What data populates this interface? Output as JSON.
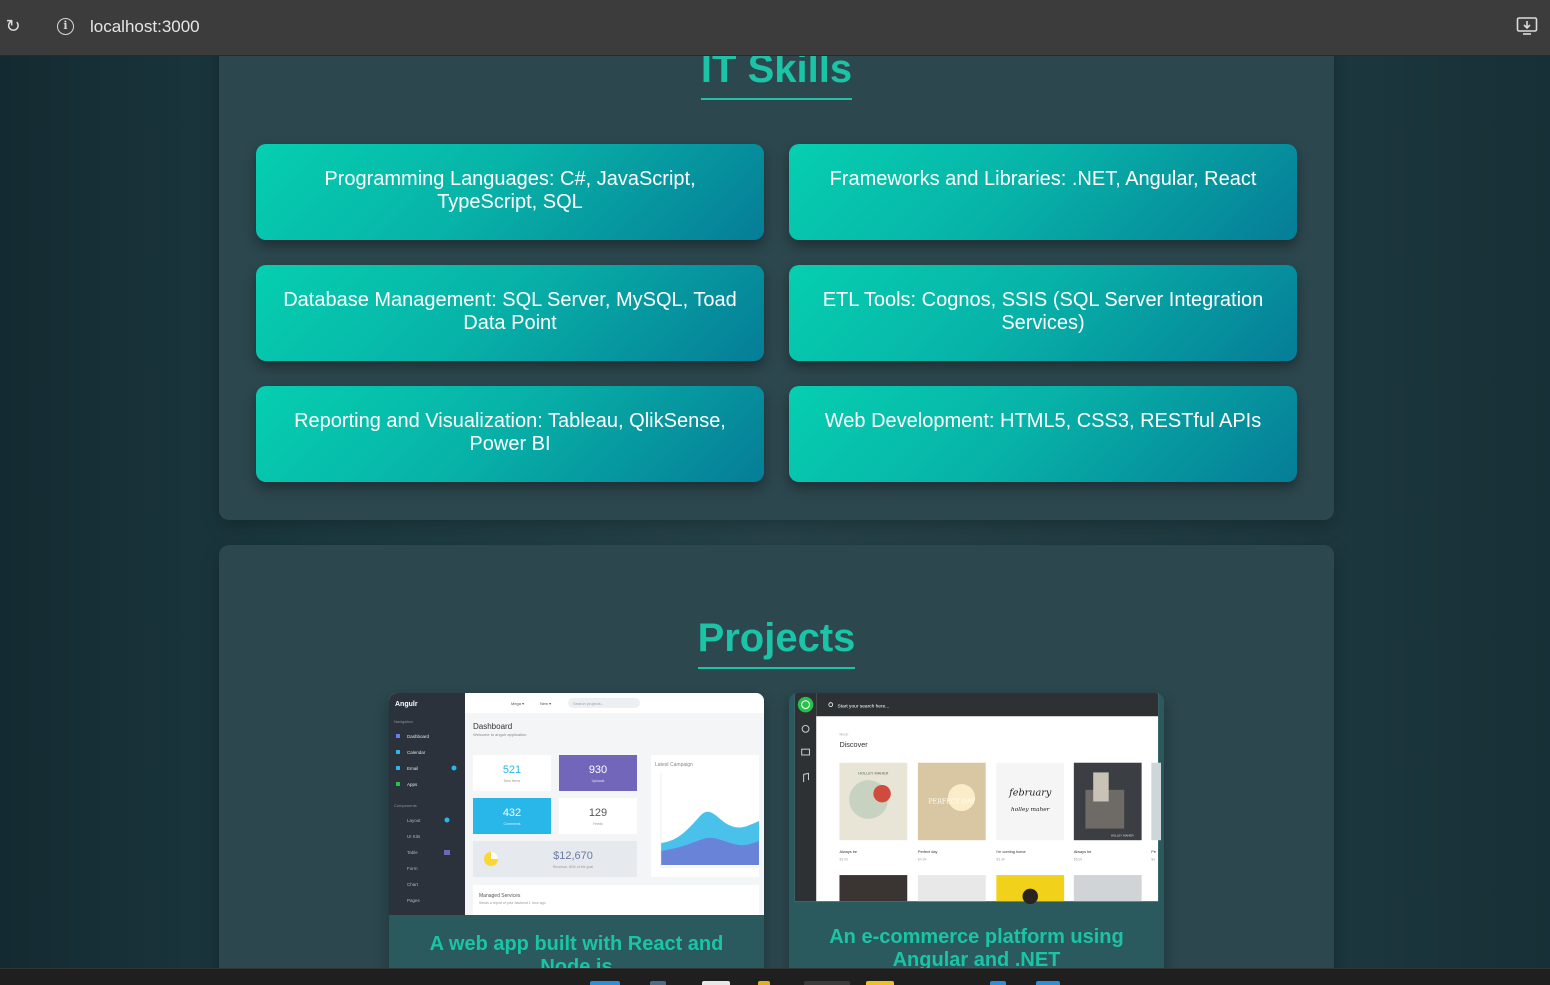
{
  "browser": {
    "url": "localhost:3000"
  },
  "skills": {
    "title": "IT Skills",
    "items": [
      {
        "label": "Programming Languages: C#, JavaScript, TypeScript, SQL"
      },
      {
        "label": "Frameworks and Libraries: .NET, Angular, React"
      },
      {
        "label": "Database Management: SQL Server, MySQL, Toad Data Point"
      },
      {
        "label": "ETL Tools: Cognos, SSIS (SQL Server Integration Services)"
      },
      {
        "label": "Reporting and Visualization: Tableau, QlikSense, Power BI"
      },
      {
        "label": "Web Development: HTML5, CSS3, RESTful APIs"
      }
    ]
  },
  "projects": {
    "title": "Projects",
    "items": [
      {
        "description": "A web app built with React and Node.js",
        "thumb": {
          "brand": "Angulr",
          "nav_header": "Navigation",
          "nav": [
            "Dashboard",
            "Calendar",
            "Email",
            "Apps"
          ],
          "components_header": "Components",
          "components": [
            "Layout",
            "UI Kits",
            "Table",
            "Form",
            "Chart",
            "Pages"
          ],
          "top_menu": [
            "Mega ▾",
            "New ▾"
          ],
          "search": "Search projects...",
          "heading": "Dashboard",
          "subheading": "Welcome to angulr application",
          "stats": [
            {
              "value": "521",
              "label": "New items"
            },
            {
              "value": "930",
              "label": "Uploads"
            },
            {
              "value": "432",
              "label": "Comments"
            },
            {
              "value": "129",
              "label": "Feeds"
            }
          ],
          "revenue": "$12,670",
          "revenue_label": "Revenue, 60% of the goal",
          "chart_title": "Latest Campaign",
          "footer_title": "Managed Services",
          "footer_text": "Sends a report of your backend 1 hour ago"
        }
      },
      {
        "description": "An e-commerce platform using Angular and .NET",
        "thumb": {
          "search": "Start your search here...",
          "kicker": "Music",
          "heading": "Discover",
          "albums": [
            {
              "title": "Always be",
              "price": "$3.99",
              "art_text": "HOLLEY MAHER"
            },
            {
              "title": "Perfect day",
              "price": "$4.99",
              "art_text": "PERFECT DAY"
            },
            {
              "title": "I'm coming home",
              "price": "$3.99",
              "art_text": "february holley maher"
            },
            {
              "title": "Always be",
              "price": "$5.99",
              "art_text": "HOLLEY MAHER"
            },
            {
              "title": "Pe",
              "price": "$4",
              "art_text": ""
            }
          ]
        }
      }
    ]
  },
  "colors": {
    "accent": "#1bc4a6",
    "card_gradient_start": "#06cfb0",
    "card_gradient_end": "#067d97",
    "section_bg": "#2c474e"
  }
}
